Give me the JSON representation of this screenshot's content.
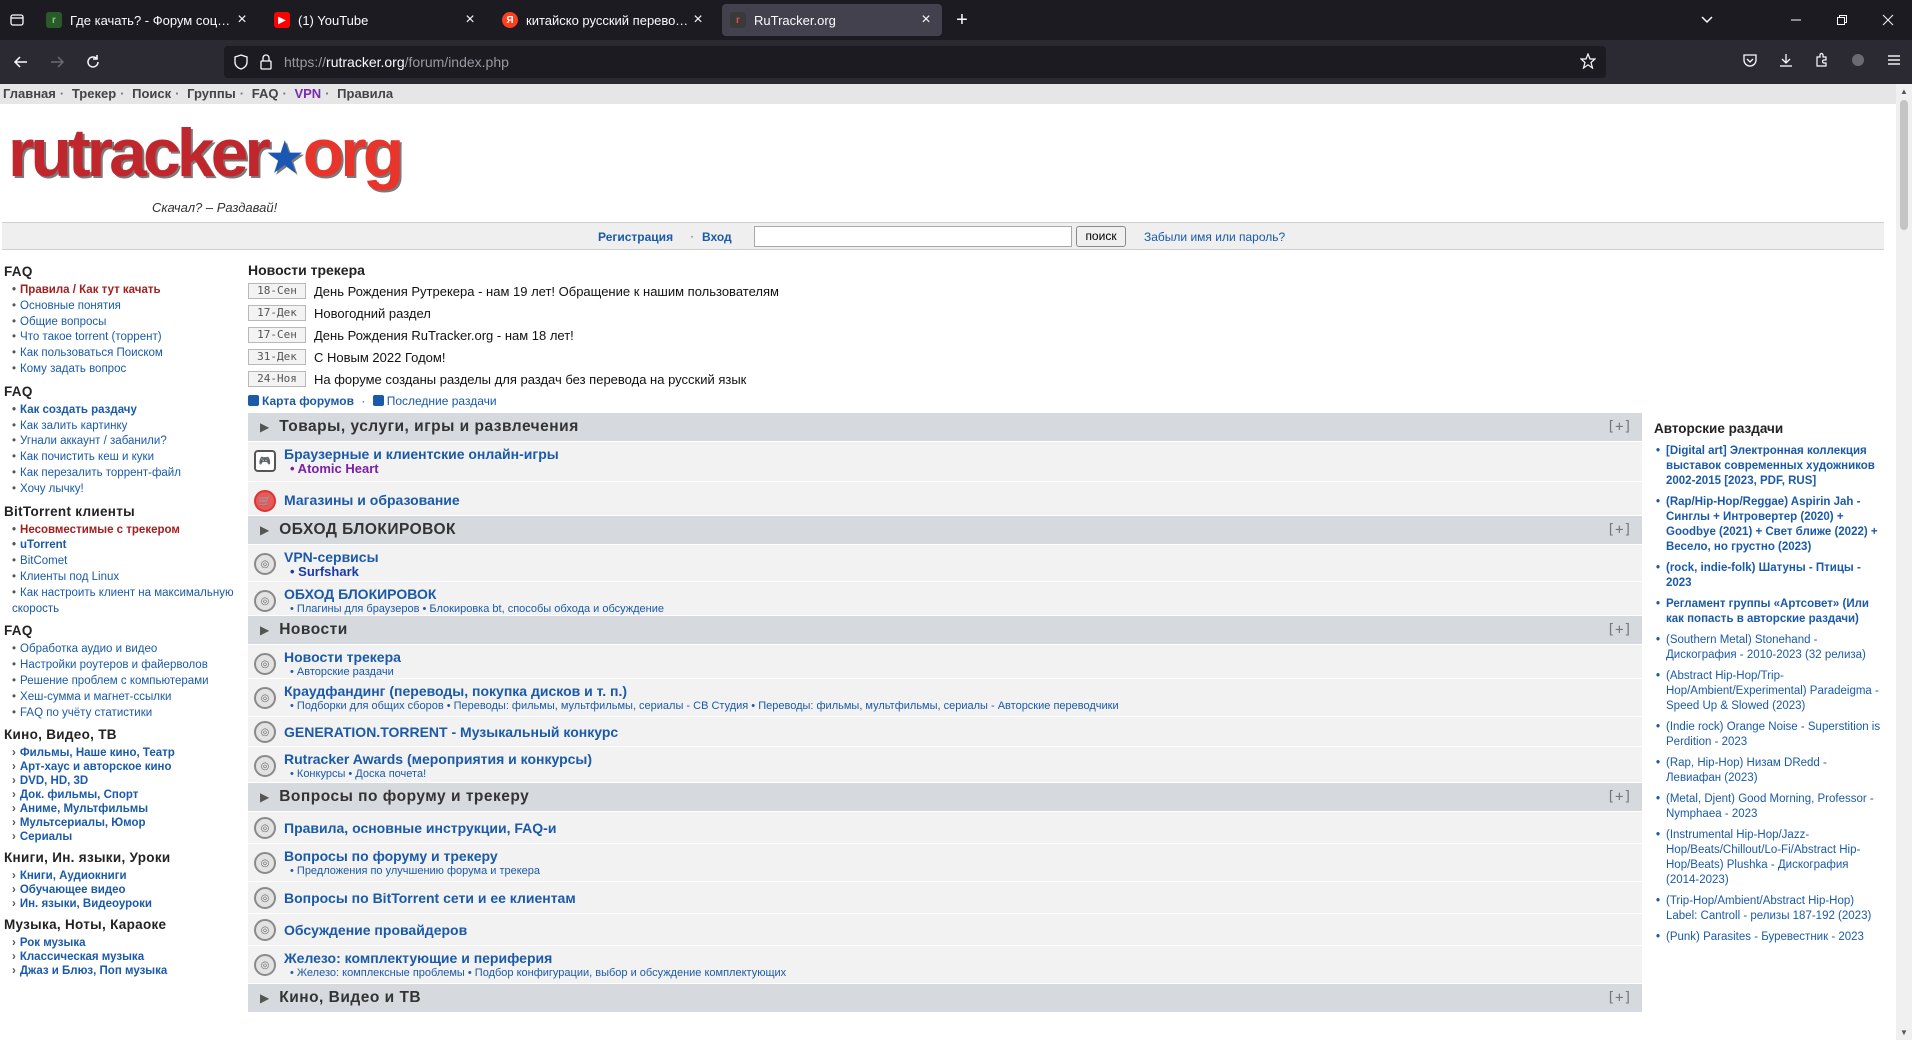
{
  "browser": {
    "tabs": [
      {
        "title": "Где качать? - Форум социаль",
        "favicon": "rutracker",
        "active": false
      },
      {
        "title": "(1) YouTube",
        "favicon": "youtube",
        "active": false
      },
      {
        "title": "китайско русский переводчик",
        "favicon": "yandex",
        "active": false
      },
      {
        "title": "RuTracker.org",
        "favicon": "rutracker",
        "active": true
      }
    ],
    "url": "https://rutracker.org/forum/index.php",
    "url_host": "rutracker.org",
    "url_prefix": "https://",
    "url_path": "/forum/index.php"
  },
  "topnav": {
    "items": [
      "Главная",
      "Трекер",
      "Поиск",
      "Группы",
      "FAQ",
      "VPN",
      "Правила"
    ]
  },
  "logo": {
    "text_main": "rutracker",
    "text_org": "org",
    "slogan": "Скачал? – Раздавай!"
  },
  "loginbar": {
    "register": "Регистрация",
    "sep": "·",
    "login": "Вход",
    "search_button": "поиск",
    "forgot": "Забыли имя или пароль?"
  },
  "sidebar": {
    "faq1_title": "FAQ",
    "faq1": [
      "Правила / Как тут качать",
      "Основные понятия",
      "Общие вопросы",
      "Что такое torrent (торрент)",
      "Как пользоваться Поиском",
      "Кому задать вопрос"
    ],
    "faq2_title": "FAQ",
    "faq2": [
      "Как создать раздачу",
      "Как залить картинку",
      "Угнали аккаунт / забанили?",
      "Как почистить кеш и куки",
      "Как перезалить торрент-файл",
      "Хочу лычку!"
    ],
    "bt_title": "BitTorrent клиенты",
    "bt": [
      "Несовместимые с трекером",
      "uTorrent",
      "BitComet",
      "Клиенты под Linux",
      "Как настроить клиент на максимальную скорость"
    ],
    "faq3_title": "FAQ",
    "faq3": [
      "Обработка аудио и видео",
      "Настройки роутеров и файерволов",
      "Решение проблем с компьютерами",
      "Хеш-сумма и магнет-ссылки",
      "FAQ по учёту статистики"
    ],
    "kino_title": "Кино, Видео, ТВ",
    "kino": [
      "Фильмы, Наше кино, Театр",
      "Арт-хаус и авторское кино",
      "DVD, HD, 3D",
      "Док. фильмы, Спорт",
      "Аниме, Мультфильмы",
      "Мультсериалы, Юмор",
      "Сериалы"
    ],
    "books_title": "Книги, Ин. языки, Уроки",
    "books": [
      "Книги, Аудиокниги",
      "Обучающее видео",
      "Ин. языки, Видеоуроки"
    ],
    "music_title": "Музыка, Ноты, Караоке",
    "music": [
      "Рок музыка",
      "Классическая музыка",
      "Джаз и Блюз, Поп музыка"
    ]
  },
  "news": {
    "title": "Новости трекера",
    "items": [
      {
        "date": "18-Сен",
        "text": "День Рождения Рутрекера - нам 19 лет! Обращение к нашим пользователям"
      },
      {
        "date": "17-Дек",
        "text": "Новогодний раздел"
      },
      {
        "date": "17-Сен",
        "text": "День Рождения RuTracker.org - нам 18 лет!"
      },
      {
        "date": "31-Дек",
        "text": "С Новым 2022 Годом!"
      },
      {
        "date": "24-Ноя",
        "text": "На форуме созданы разделы для раздач без перевода на русский язык"
      }
    ],
    "map_link": "Карта форумов",
    "map_sep": "·",
    "latest_link": "Последние раздачи"
  },
  "forum": {
    "expand": "[+]",
    "cat1": "Товары, услуги, игры и развлечения",
    "cat1_rows": [
      {
        "title": "Браузерные и клиентские онлайн-игры",
        "sub": "• Atomic Heart"
      },
      {
        "title": "Магазины и образование",
        "sub": ""
      }
    ],
    "cat2": "ОБХОД БЛОКИРОВОК",
    "cat2_rows": [
      {
        "title": "VPN-сервисы",
        "sub": "• Surfshark"
      },
      {
        "title": "ОБХОД БЛОКИРОВОК",
        "sub": "• Плагины для браузеров • Блокировка bt, способы обхода и обсуждение"
      }
    ],
    "cat3": "Новости",
    "cat3_rows": [
      {
        "title": "Новости трекера",
        "sub": "• Авторские раздачи"
      },
      {
        "title": "Краудфандинг (переводы, покупка дисков и т. п.)",
        "sub": "• Подборки для общих сборов • Переводы: фильмы, мультфильмы, сериалы - СВ Студия • Переводы: фильмы, мультфильмы, сериалы - Авторские переводчики"
      },
      {
        "title": "GENERATION.TORRENT - Музыкальный конкурс",
        "sub": ""
      },
      {
        "title": "Rutracker Awards (мероприятия и конкурсы)",
        "sub": "• Конкурсы • Доска почета!"
      }
    ],
    "cat4": "Вопросы по форуму и трекеру",
    "cat4_rows": [
      {
        "title": "Правила, основные инструкции, FAQ-и",
        "sub": ""
      },
      {
        "title": "Вопросы по форуму и трекеру",
        "sub": "• Предложения по улучшению форума и трекера"
      },
      {
        "title": "Вопросы по BitTorrent сети и ее клиентам",
        "sub": ""
      },
      {
        "title": "Обсуждение провайдеров",
        "sub": ""
      },
      {
        "title": "Железо: комплектующие и периферия",
        "sub": "• Железо: комплексные проблемы • Подбор конфигурации, выбор и обсуждение комплектующих"
      }
    ],
    "cat5": "Кино, Видео и ТВ"
  },
  "right": {
    "title": "Авторские раздачи",
    "items": [
      {
        "text": "[Digital art] Электронная коллекция выставок современных художников 2002-2015 [2023, PDF, RUS]",
        "bold": true
      },
      {
        "text": "(Rap/Hip-Hop/Reggae) Aspirin Jah - Синглы + Интровертер (2020) + Goodbye (2021) + Свет ближе (2022) + Весело, но грустно (2023)",
        "bold": true
      },
      {
        "text": "(rock, indie-folk) Шатуны - Птицы - 2023",
        "bold": true
      },
      {
        "text": "Регламент группы «Артсовет» (Или как попасть в авторские раздачи)",
        "bold": true
      },
      {
        "text": "(Southern Metal) Stonehand - Дискография - 2010-2023 (32 релиза)",
        "bold": false
      },
      {
        "text": "(Abstract Hip-Hop/Trip-Hop/Ambient/Experimental) Paradeigma - Speed Up & Slowed (2023)",
        "bold": false
      },
      {
        "text": "(Indie rock) Orange Noise - Superstition is Perdition - 2023",
        "bold": false
      },
      {
        "text": "(Rap, Hip-Hop) Низам DRedd - Левиафан (2023)",
        "bold": false
      },
      {
        "text": "(Metal, Djent) Good Morning, Professor - Nymphaea - 2023",
        "bold": false
      },
      {
        "text": "(Instrumental Hip-Hop/Jazz-Hop/Beats/Chillout/Lo-Fi/Abstract Hip-Hop/Beats) Plushka - Дискография (2014-2023)",
        "bold": false
      },
      {
        "text": "(Trip-Hop/Ambient/Abstract Hip-Hop) Label: Cantroll - релизы 187-192 (2023)",
        "bold": false
      },
      {
        "text": "(Punk) Parasites - Буревестник - 2023",
        "bold": false
      }
    ]
  }
}
